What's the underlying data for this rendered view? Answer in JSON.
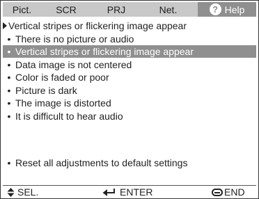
{
  "tabs": [
    {
      "label": "Pict.",
      "active": false
    },
    {
      "label": "SCR",
      "active": false
    },
    {
      "label": "PRJ",
      "active": false
    },
    {
      "label": "Net.",
      "active": false
    },
    {
      "label": "Help",
      "active": true,
      "icon": "question-icon"
    }
  ],
  "heading": "Vertical stripes or flickering image appear",
  "items": [
    {
      "label": "There is no picture or audio",
      "selected": false
    },
    {
      "label": "Vertical stripes or flickering image appear",
      "selected": true
    },
    {
      "label": "Data image is not centered",
      "selected": false
    },
    {
      "label": "Color is faded or poor",
      "selected": false
    },
    {
      "label": "Picture is dark",
      "selected": false
    },
    {
      "label": "The image is distorted",
      "selected": false
    },
    {
      "label": "It is difficult to hear audio",
      "selected": false
    },
    {
      "label": "Reset all adjustments to default settings",
      "selected": false
    }
  ],
  "footer": {
    "select_icon": "up-down-arrows-icon",
    "select_label": "SEL.",
    "enter_icon": "enter-arrow-icon",
    "enter_label": "ENTER",
    "end_icon": "end-button-icon",
    "end_label": "END"
  },
  "colors": {
    "tab_bar": "#c8c8c8",
    "highlight": "#8f8f8f",
    "text": "#222222",
    "background": "#ffffff"
  }
}
